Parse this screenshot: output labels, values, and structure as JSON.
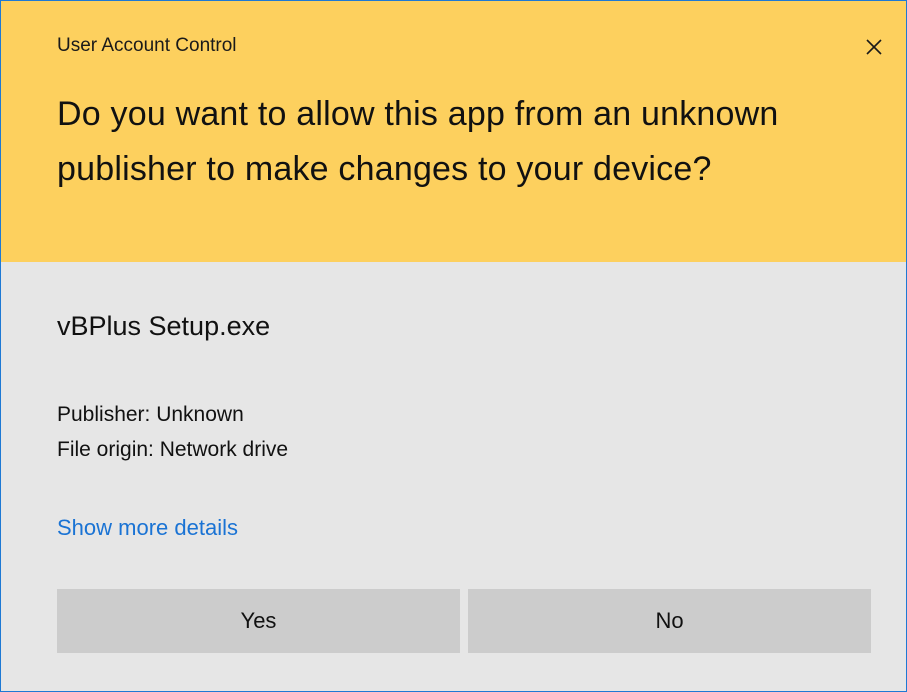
{
  "window": {
    "title": "User Account Control",
    "close_icon": "close-icon"
  },
  "header": {
    "question": "Do you want to allow this app from an unknown publisher to make changes to your device?"
  },
  "app": {
    "name": "vBPlus Setup.exe",
    "publisher": "Publisher: Unknown",
    "file_origin": "File origin: Network drive"
  },
  "details": {
    "link_label": "Show more details"
  },
  "buttons": {
    "yes_label": "Yes",
    "no_label": "No"
  },
  "colors": {
    "header_bg": "#fdd05e",
    "body_bg": "#e6e6e6",
    "button_bg": "#cccccc",
    "link": "#1a73d4",
    "border": "#1e79d4"
  }
}
